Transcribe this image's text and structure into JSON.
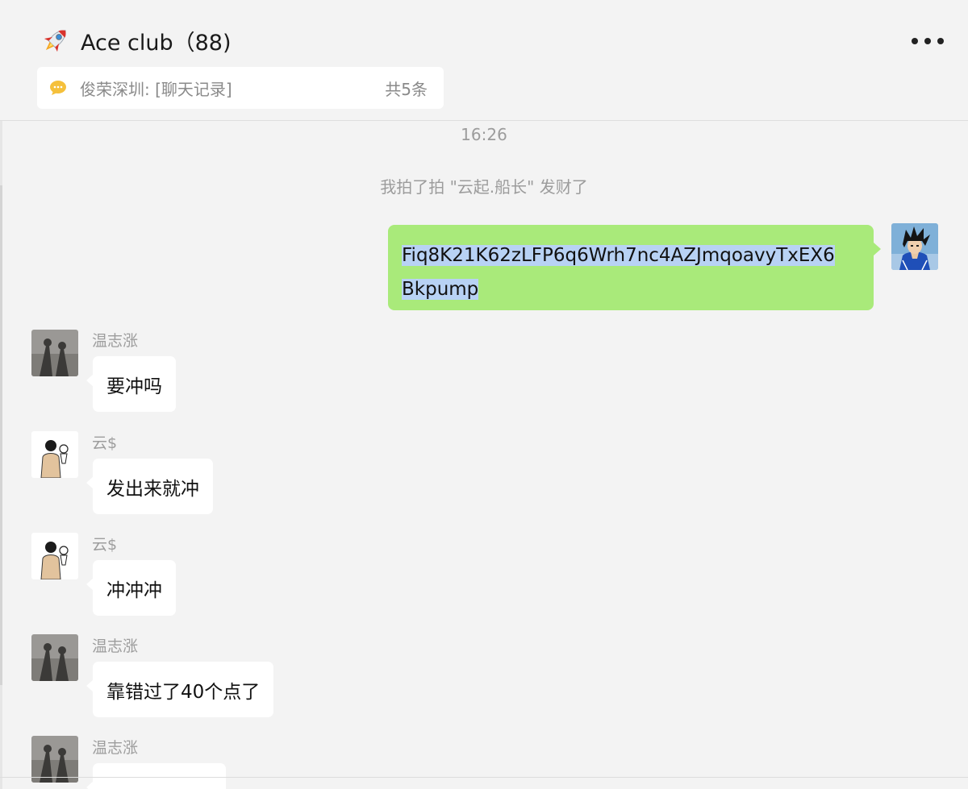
{
  "header": {
    "title": "Ace club（88)",
    "pinned_text": "俊荣深圳: [聊天记录]",
    "pinned_count": "共5条"
  },
  "chat": {
    "timestamp": "16:26",
    "system_message": "我拍了拍 \"云起.船长\" 发财了",
    "my_message": {
      "line1": "Fiq8K21K62zLFP6q6Wrh7nc4AZJmqoavyTxEX6",
      "line2": "Bkpump"
    },
    "messages": [
      {
        "sender": "温志涨",
        "text": "要冲吗"
      },
      {
        "sender": "云$",
        "text": "发出来就冲"
      },
      {
        "sender": "云$",
        "text": "冲冲冲"
      },
      {
        "sender": "温志涨",
        "text": "靠错过了40个点了"
      },
      {
        "sender": "温志涨",
        "text": ""
      }
    ]
  },
  "colors": {
    "background": "#f3f3f3",
    "my_bubble": "#a9ea7a",
    "their_bubble": "#ffffff",
    "selection": "#b8d2f4",
    "secondary_text": "#9c9c9c"
  },
  "icons": {
    "title_emoji": "rocket-icon",
    "pinned": "chat-bubble-icon",
    "menu": "more-icon"
  }
}
